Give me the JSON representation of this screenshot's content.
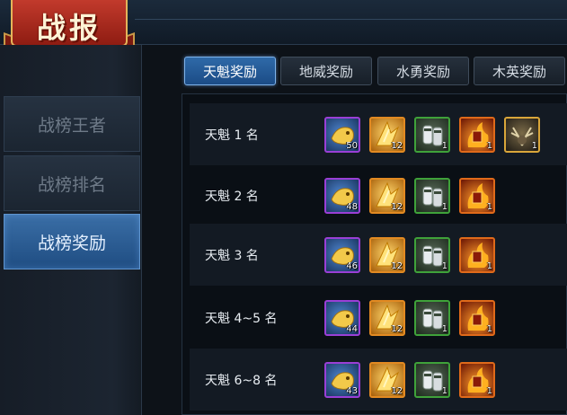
{
  "banner": {
    "title": "战报"
  },
  "sidebar": {
    "items": [
      {
        "label": "战榜王者",
        "active": false
      },
      {
        "label": "战榜排名",
        "active": false
      },
      {
        "label": "战榜奖励",
        "active": true
      }
    ]
  },
  "tabs": [
    {
      "label": "天魁奖励",
      "active": true
    },
    {
      "label": "地威奖励",
      "active": false
    },
    {
      "label": "水勇奖励",
      "active": false
    },
    {
      "label": "木英奖励",
      "active": false
    }
  ],
  "rewards": [
    {
      "rank": "天魁 1 名",
      "items": [
        {
          "icon": "golden-fish-icon",
          "rarity": "purple",
          "count": "50"
        },
        {
          "icon": "golden-wing-icon",
          "rarity": "orange",
          "count": "12"
        },
        {
          "icon": "white-gauntlets-icon",
          "rarity": "green",
          "count": "1"
        },
        {
          "icon": "flame-chest-icon",
          "rarity": "red",
          "count": "1"
        },
        {
          "icon": "antler-mount-icon",
          "rarity": "gold",
          "count": "1"
        }
      ]
    },
    {
      "rank": "天魁 2 名",
      "items": [
        {
          "icon": "golden-fish-icon",
          "rarity": "purple",
          "count": "48"
        },
        {
          "icon": "golden-wing-icon",
          "rarity": "orange",
          "count": "12"
        },
        {
          "icon": "white-gauntlets-icon",
          "rarity": "green",
          "count": "1"
        },
        {
          "icon": "flame-chest-icon",
          "rarity": "red",
          "count": "1"
        }
      ]
    },
    {
      "rank": "天魁 3 名",
      "items": [
        {
          "icon": "golden-fish-icon",
          "rarity": "purple",
          "count": "46"
        },
        {
          "icon": "golden-wing-icon",
          "rarity": "orange",
          "count": "12"
        },
        {
          "icon": "white-gauntlets-icon",
          "rarity": "green",
          "count": "1"
        },
        {
          "icon": "flame-chest-icon",
          "rarity": "red",
          "count": "1"
        }
      ]
    },
    {
      "rank": "天魁 4~5 名",
      "items": [
        {
          "icon": "golden-fish-icon",
          "rarity": "purple",
          "count": "44"
        },
        {
          "icon": "golden-wing-icon",
          "rarity": "orange",
          "count": "12"
        },
        {
          "icon": "white-gauntlets-icon",
          "rarity": "green",
          "count": "1"
        },
        {
          "icon": "flame-chest-icon",
          "rarity": "red",
          "count": "1"
        }
      ]
    },
    {
      "rank": "天魁 6~8 名",
      "items": [
        {
          "icon": "golden-fish-icon",
          "rarity": "purple",
          "count": "43"
        },
        {
          "icon": "golden-wing-icon",
          "rarity": "orange",
          "count": "12"
        },
        {
          "icon": "white-gauntlets-icon",
          "rarity": "green",
          "count": "1"
        },
        {
          "icon": "flame-chest-icon",
          "rarity": "red",
          "count": "1"
        }
      ]
    }
  ],
  "colors": {
    "accent": "#2f6aa8",
    "banner": "#b22e22",
    "rarity_purple": "#9a3fd6",
    "rarity_orange": "#e28a22",
    "rarity_green": "#3fa23a",
    "rarity_red": "#e06a1a"
  }
}
